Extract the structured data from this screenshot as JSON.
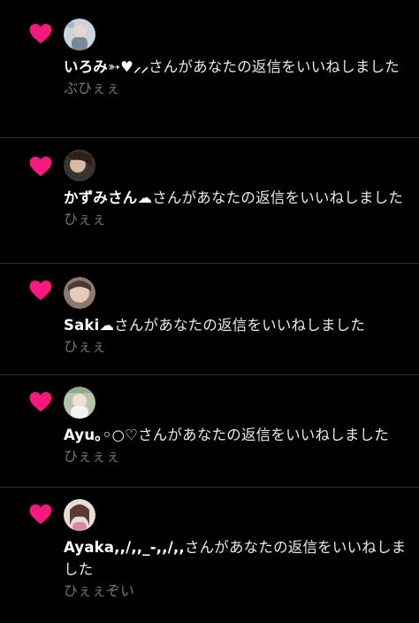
{
  "colors": {
    "background": "#000000",
    "heart": "#f91880",
    "text": "#e7e9ea",
    "subtext": "#71767b",
    "divider": "#2f3336"
  },
  "notifications": [
    {
      "icon": "heart-icon",
      "name": "いろみ➳♥︎⸝⸝",
      "action": "さんがあなたの返信をいいねしました",
      "reply": "ぶひぇぇ"
    },
    {
      "icon": "heart-icon",
      "name": "かずみさん☁",
      "action": "さんがあなたの返信をいいねしました",
      "reply": "ひぇぇ"
    },
    {
      "icon": "heart-icon",
      "name": "Saki☁",
      "action": "さんがあなたの返信をいいねしました",
      "reply": "ひぇぇ"
    },
    {
      "icon": "heart-icon",
      "name": "Ayu｡◦○♡",
      "action": "さんがあなたの返信をいいねしました",
      "reply": "ひぇぇぇ"
    },
    {
      "icon": "heart-icon",
      "name": "Ayaka,,/,,_-,,/,,",
      "action": "さんがあなたの返信をいいねしました",
      "reply": "ひぇぇぞい"
    }
  ]
}
